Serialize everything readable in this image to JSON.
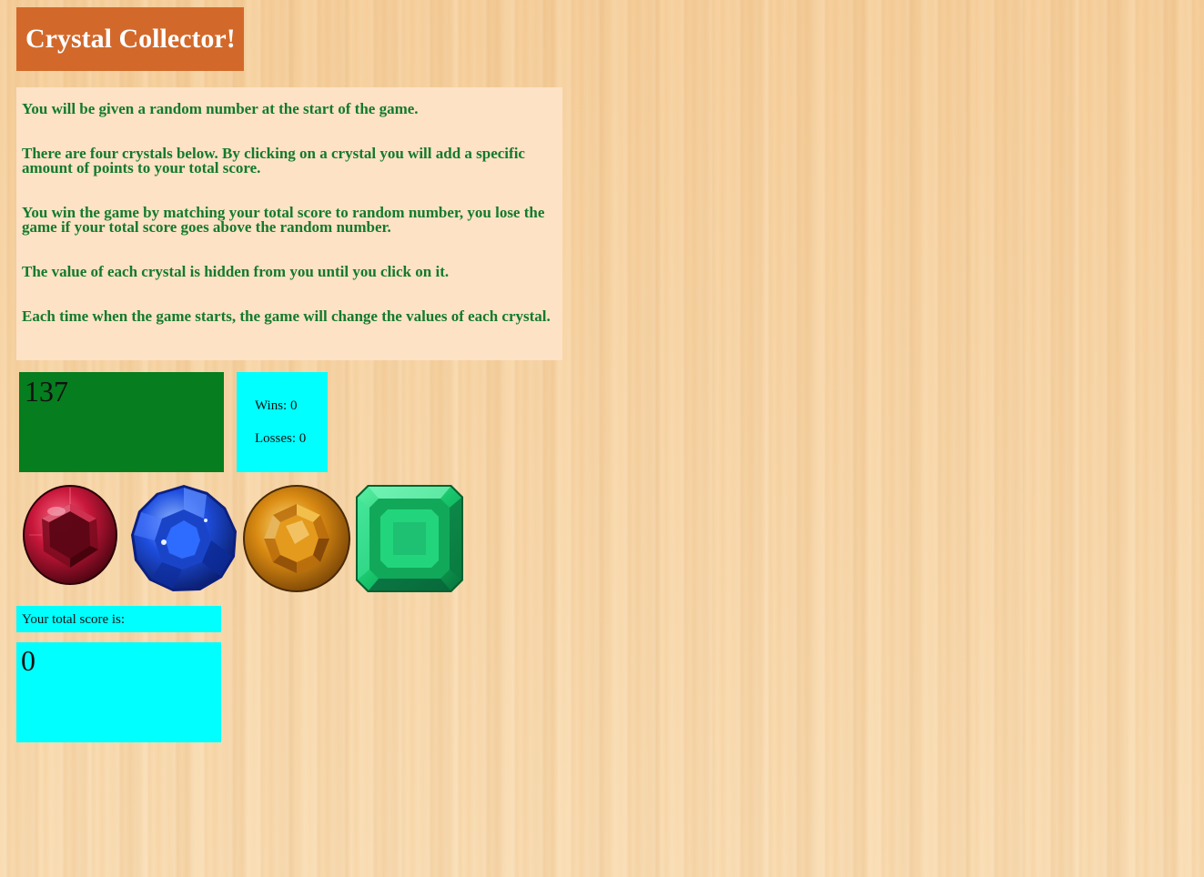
{
  "header": {
    "title": "Crystal Collector!"
  },
  "instructions": [
    "You will be given a random number at the start of the game.",
    "There are four crystals below. By clicking on a crystal you will add a specific amount of points to your total score.",
    "You win the game by matching your total score to random number, you lose the game if your total score goes above the random number.",
    "The value of each crystal is hidden from you until you click on it.",
    "Each time when the game starts, the game will change the values of each crystal."
  ],
  "game": {
    "random_number": "137",
    "wins": "Wins: 0",
    "losses": "Losses: 0",
    "score_label": "Your total score is:",
    "total_score": "0"
  },
  "crystals": [
    {
      "name": "ruby",
      "icon": "ruby-crystal-icon"
    },
    {
      "name": "sapphire",
      "icon": "sapphire-crystal-icon"
    },
    {
      "name": "topaz",
      "icon": "topaz-crystal-icon"
    },
    {
      "name": "emerald",
      "icon": "emerald-crystal-icon"
    }
  ],
  "colors": {
    "title_bg": "#d2692b",
    "instructions_bg": "#fde2c6",
    "instructions_text": "#137a2b",
    "random_bg": "#067d1f",
    "cyan_panel": "#00ffff",
    "ruby": "#c8173a",
    "sapphire": "#1f4fe0",
    "topaz": "#d98a12",
    "emerald": "#17c46a"
  }
}
